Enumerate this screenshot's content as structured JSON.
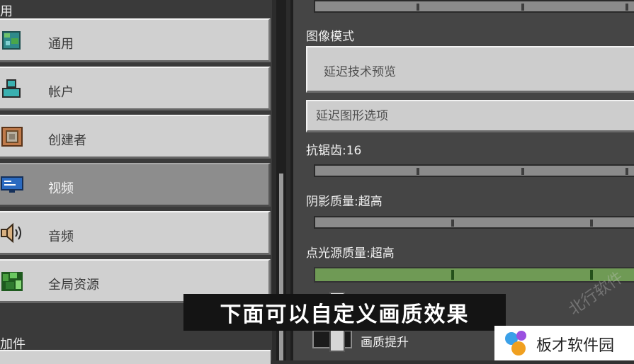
{
  "left_panel": {
    "section_general": "用",
    "section_addons": "加件",
    "items": [
      {
        "label": "通用",
        "icon": "globe-icon"
      },
      {
        "label": "帐户",
        "icon": "account-icon"
      },
      {
        "label": "创建者",
        "icon": "creator-icon"
      },
      {
        "label": "视频",
        "icon": "monitor-icon",
        "selected": true
      },
      {
        "label": "音频",
        "icon": "speaker-icon"
      },
      {
        "label": "全局资源",
        "icon": "resource-pack-icon"
      }
    ]
  },
  "right_panel": {
    "graphics_mode_label": "图像模式",
    "graphics_mode_value": "延迟技术预览",
    "deferred_options_label": "延迟图形选项",
    "antialias_label": "抗锯齿:16",
    "antialias_level": 0.92,
    "shadow_label": "阴影质量:超高",
    "shadow_level": 1.0,
    "point_light_label": "点光源质量:超高",
    "point_light_level": 1.0,
    "upscaling_label": "画质提升",
    "upscaling_on": true
  },
  "overlay": {
    "subtitle": "下面可以自定义画质效果",
    "watermark_text": "板才软件园",
    "diagonal_watermark": "北行软件"
  },
  "colors": {
    "panel_bg": "#454545",
    "button_bg": "#d0d0d0",
    "selected_bg": "#8d8d8d",
    "slider_green": "#6f9a55",
    "subtitle_bg": "#141414"
  }
}
